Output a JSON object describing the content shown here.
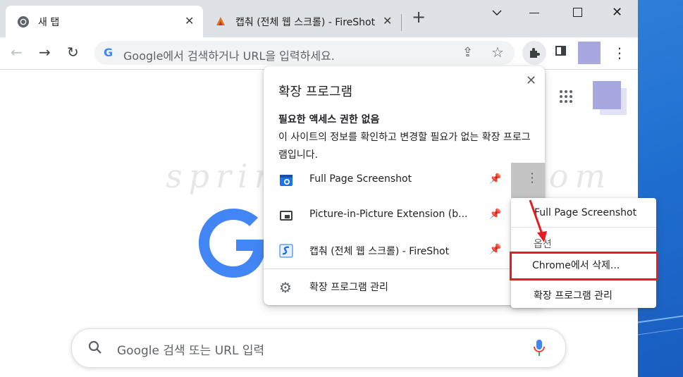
{
  "tabs": [
    {
      "title": "새 탭",
      "icon": "chrome-icon",
      "active": true
    },
    {
      "title": "캡춰 (전체 웹 스크롤) - FireShot",
      "icon": "fireshot-icon",
      "active": false
    }
  ],
  "toolbar": {
    "omnibox_placeholder": "Google에서 검색하거나 URL을 입력하세요."
  },
  "watermark": "springit.tistory.com",
  "search": {
    "placeholder": "Google 검색 또는 URL 입력"
  },
  "extensions_popup": {
    "title": "확장 프로그램",
    "section_heading": "필요한 액세스 권한 없음",
    "section_desc": "이 사이트의 정보를 확인하고 변경할 필요가 없는 확장 프로그램입니다.",
    "items": [
      {
        "name": "Full Page Screenshot",
        "icon": "camera-icon"
      },
      {
        "name": "Picture-in-Picture Extension (b...",
        "icon": "pip-icon"
      },
      {
        "name": "캡춰 (전체 웹 스크롤) - FireShot",
        "icon": "fireshot-icon"
      }
    ],
    "manage_label": "확장 프로그램 관리"
  },
  "context_menu": {
    "title": "Full Page Screenshot",
    "options": "옵션",
    "remove": "Chrome에서 삭제...",
    "manage": "확장 프로그램 관리"
  },
  "colors": {
    "highlight": "#e51c23",
    "arrow": "#e51c23",
    "google_blue": "#4285f4",
    "desktop_blue": "#1f6fd0"
  }
}
